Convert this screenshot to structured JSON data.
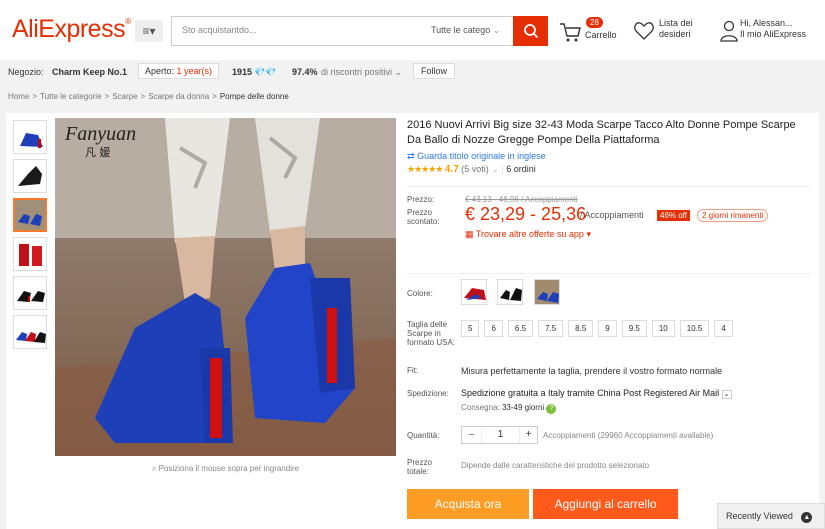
{
  "header": {
    "logo": "AliExpress",
    "logo_mark": "®",
    "menu_label": "≡▾",
    "search_placeholder": "Sto acquistantdo...",
    "search_category": "Tutte le catego",
    "cart_count": "28",
    "cart_label": "Carrello",
    "wishlist_label": "Lista dei desideri",
    "user_greeting": "Hi, Alessan...",
    "user_sub": "Il mio AliExpress"
  },
  "store": {
    "label": "Negozio:",
    "name": "Charm Keep No.1",
    "open_prefix": "Aperto:",
    "open_years": "1 year(s)",
    "score": "1915",
    "feedback_pct": "97.4%",
    "feedback_text": "di riscontri positivi",
    "follow": "Follow"
  },
  "breadcrumb": [
    "Home",
    "Tutte le categorie",
    "Scarpe",
    "Scarpe da donna",
    "Pompe delle donne"
  ],
  "gallery": {
    "zoom_hint": "Posiziona il mouse sopra per ingrandire",
    "brand_watermark": "Fanyuan",
    "thumb_count": 6,
    "active_thumb": 3
  },
  "product": {
    "title": "2016 Nuovi Arrivi Big size 32-43 Moda Scarpe Tacco Alto Donne Pompe Scarpe Da Ballo di Nozze Gregge Pompe Della Piattaforma",
    "translate_link": "Guarda titolo originale in inglese",
    "stars": "★★★★★",
    "rating": "4.7",
    "votes": "(5 voti)",
    "orders": "6 ordini"
  },
  "price": {
    "label": "Prezzo:",
    "original": "€ 43,13 - 46,96 / Accoppiamenti",
    "disc_label_1": "Prezzo",
    "disc_label_2": "scontato:",
    "discounted": "€ 23,29 - 25,36",
    "unit": "/ Accoppiamenti",
    "off": "46% off",
    "days_left": "2 giorni rimanenti",
    "other_offers": "Trovare altre offerte su app"
  },
  "options": {
    "color_label": "Colore:",
    "size_label": "Taglia delle Scarpe in formato USA:",
    "sizes": [
      "5",
      "6",
      "6.5",
      "7.5",
      "8.5",
      "9",
      "9.5",
      "10",
      "10.5",
      "4"
    ],
    "fit_label": "Fit:",
    "fit_text": "Misura perfettamente la taglia, prendere il vostro formato normale",
    "shipping_label": "Spedizione:",
    "shipping_text": "Spedizione gratuita a Italy tramite China Post Registered Air Mail",
    "delivery_prefix": "Consegna:",
    "delivery_days": "33-49 giorni",
    "qty_label": "Quantità:",
    "qty_minus": "–",
    "qty_value": "1",
    "qty_plus": "+",
    "qty_available": "Accoppiamenti (29960 Accoppiamenti available)",
    "total_label_1": "Prezzo",
    "total_label_2": "totale:",
    "total_text": "Dipende dalle caratteristiche del prodotto selezionato"
  },
  "actions": {
    "buy_now": "Acquista ora",
    "add_to_cart": "Aggiungi al carrello"
  },
  "recently_viewed": "Recently Viewed",
  "colors": {
    "brand": "#e62e04",
    "buy": "#ff9c23",
    "cart": "#ff5a1c",
    "link": "#2a7ae2",
    "shoe_blue": "#1f3fb8"
  }
}
